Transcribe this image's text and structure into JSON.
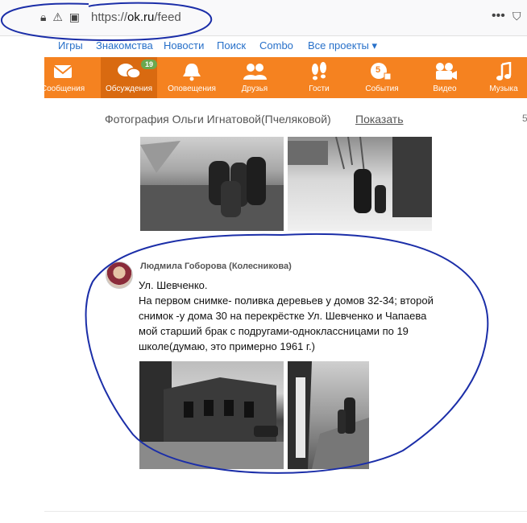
{
  "browser": {
    "url_prefix": "https://",
    "url_domain": "ok.ru",
    "url_path": "/feed",
    "more_symbol": "•••",
    "bookmark_symbol": "⛉"
  },
  "toplinks": [
    "Игры",
    "Знакомства",
    "Новости",
    "Поиск",
    "Combo",
    "Все проекты ▾"
  ],
  "nav": {
    "items": [
      {
        "label": "Сообщения",
        "icon": "envelope-icon"
      },
      {
        "label": "Обсуждения",
        "icon": "chat-bubbles-icon",
        "badge": "19"
      },
      {
        "label": "Оповещения",
        "icon": "bell-icon"
      },
      {
        "label": "Друзья",
        "icon": "people-icon"
      },
      {
        "label": "Гости",
        "icon": "footprints-icon"
      },
      {
        "label": "События",
        "icon": "events-icon",
        "badge_inner": "5"
      },
      {
        "label": "Видео",
        "icon": "video-camera-icon"
      },
      {
        "label": "Музыка",
        "icon": "music-note-icon"
      }
    ],
    "accent": "#f58220"
  },
  "feed": {
    "caption": "Фотография Ольги Игнатовой(Пчеляковой)",
    "show_link": "Показать",
    "cut_digit": "5",
    "post": {
      "author": "Людмила Гоборова (Колесникова)",
      "lines": [
        "Ул. Шевченко.",
        "На первом снимке- поливка деревьев у домов 32-34; второй",
        "снимок -у дома 30 на перекрёстке  Ул. Шевченко и Чапаева",
        "мой старший брак с подругами-одноклассницами по 19",
        "школе(думаю, это примерно 1961 г.)"
      ]
    }
  }
}
